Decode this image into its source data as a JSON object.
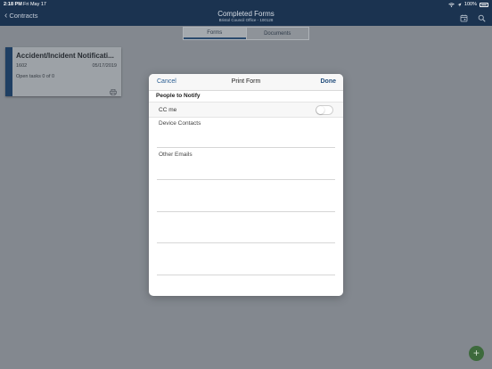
{
  "status_bar": {
    "time": "2:18 PM",
    "date": "Fri May 17",
    "battery": "100%"
  },
  "nav": {
    "back_label": "Contracts",
    "title": "Completed Forms",
    "subtitle": "Bristol Council Office - 100128",
    "icons": [
      "calendar-icon",
      "search-icon"
    ]
  },
  "tabs": [
    {
      "label": "Forms",
      "active": true
    },
    {
      "label": "Documents",
      "active": false
    }
  ],
  "form_card": {
    "title": "Accident/Incident Notificati...",
    "id": "1602",
    "date": "05/17/2019",
    "tasks": "Open tasks 0 of 0",
    "icon": "print-icon"
  },
  "modal": {
    "cancel_label": "Cancel",
    "title": "Print Form",
    "done_label": "Done",
    "section_title": "People to Notify",
    "cc_label": "CC me",
    "cc_enabled": false,
    "device_contacts_label": "Device Contacts",
    "other_emails_label": "Other Emails"
  },
  "fab_icon": "add-icon",
  "colors": {
    "nav_background": "#1b3350",
    "accent": "#1f3f63",
    "link": "#2a5e93",
    "fab": "#3d6a3c"
  }
}
